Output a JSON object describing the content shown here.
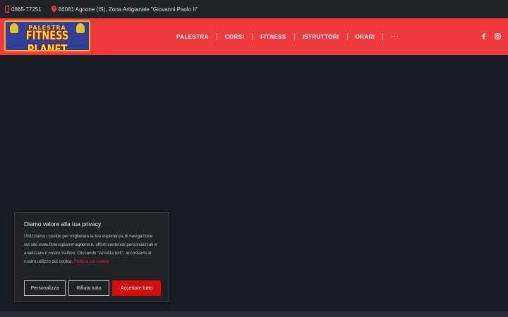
{
  "topbar": {
    "phone": "0865-77251",
    "address": "86081 Agnone (IS), Zona Artigianale \"Giovanni Paolo II\""
  },
  "logo": {
    "line1": "PALESTRA",
    "line2": "FITNESS PLANET"
  },
  "nav": {
    "items": [
      "PALESTRA",
      "CORSI",
      "FITNESS",
      "ISTRUTTORI",
      "ORARI"
    ],
    "more": "···"
  },
  "social": {
    "icons": [
      "facebook-icon",
      "instagram-icon"
    ]
  },
  "cookie": {
    "title": "Diamo valore alla tua privacy",
    "text": "Utilizziamo i cookie per migliorare la tua esperienza di navigazione sul sito www.fitnessplanet-agnone.it, offrirti contenuti personalizzati e analizzare il nostro traffico. Cliccando \"Accetta tutti\", acconsenti al nostro utilizzo dei cookie.",
    "link": "Politica sui cookie",
    "customize_label": "Personalizza",
    "reject_label": "Rifiuta tutto",
    "accept_label": "Accettare tutto"
  },
  "colors": {
    "header_red": "#f0393e",
    "accept_red": "#d40d0d",
    "background": "#1c1d22"
  }
}
